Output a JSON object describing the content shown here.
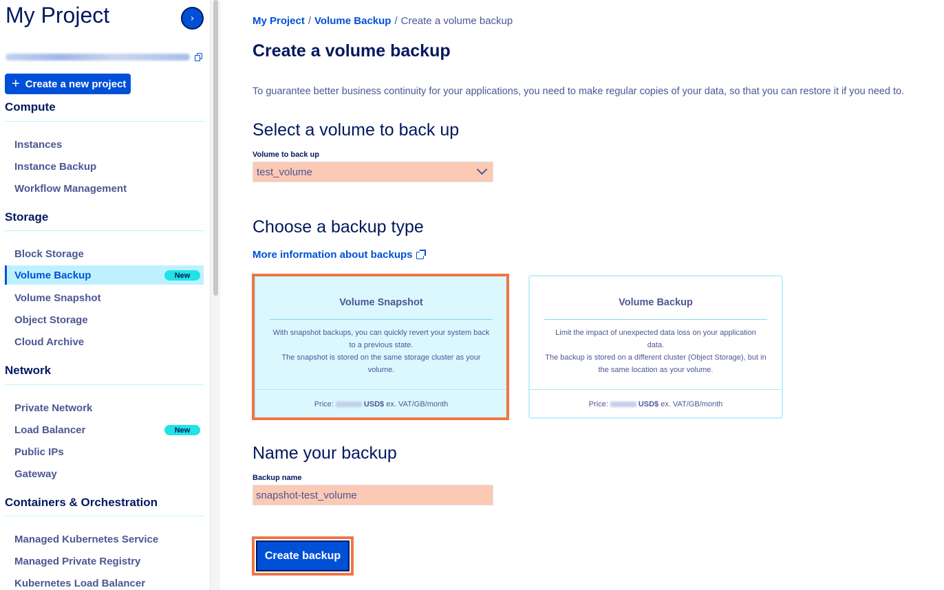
{
  "sidebar": {
    "project_title": "My Project",
    "collapse_glyph": "›",
    "create_label": "Create a new project",
    "create_glyph": "+",
    "sections": {
      "compute": "Compute",
      "storage": "Storage",
      "network": "Network",
      "containers": "Containers & Orchestration"
    },
    "items": {
      "instances": "Instances",
      "instance_backup": "Instance Backup",
      "workflow_management": "Workflow Management",
      "block_storage": "Block Storage",
      "volume_backup": "Volume Backup",
      "volume_snapshot": "Volume Snapshot",
      "object_storage": "Object Storage",
      "cloud_archive": "Cloud Archive",
      "private_network": "Private Network",
      "load_balancer": "Load Balancer",
      "public_ips": "Public IPs",
      "gateway": "Gateway",
      "managed_kubernetes": "Managed Kubernetes Service",
      "managed_private_registry": "Managed Private Registry",
      "kubernetes_load_balancer": "Kubernetes Load Balancer"
    },
    "badge_new": "New"
  },
  "breadcrumb": {
    "project": "My Project",
    "volume_backup": "Volume Backup",
    "current": "Create a volume backup",
    "sep": "/"
  },
  "page": {
    "title": "Create a volume backup",
    "intro": "To guarantee better business continuity for your applications, you need to make regular copies of your data, so that you can restore it if you need to."
  },
  "select_volume": {
    "heading": "Select a volume to back up",
    "label": "Volume to back up",
    "value": "test_volume"
  },
  "backup_type": {
    "heading": "Choose a backup type",
    "info_link": "More information about backups",
    "cards": [
      {
        "title": "Volume Snapshot",
        "line1": "With snapshot backups, you can quickly revert your system back to a previous state.",
        "line2": "The snapshot is stored on the same storage cluster as your volume.",
        "price_label": "Price:",
        "currency": "USD$",
        "price_unit": "ex. VAT/GB/month"
      },
      {
        "title": "Volume Backup",
        "line1": "Limit the impact of unexpected data loss on your application data.",
        "line2": "The backup is stored on a different cluster (Object Storage), but in the same location as your volume.",
        "price_label": "Price:",
        "currency": "USD$",
        "price_unit": "ex. VAT/GB/month"
      }
    ]
  },
  "name_backup": {
    "heading": "Name your backup",
    "label": "Backup name",
    "value": "snapshot-test_volume"
  },
  "actions": {
    "create_backup": "Create backup"
  },
  "colors": {
    "primary": "#0050d7",
    "navy": "#00185e",
    "highlight": "#ef7547",
    "field_fill": "#fbc9b4",
    "selected_card": "#dbf8ff",
    "badge": "#20e3e3"
  }
}
